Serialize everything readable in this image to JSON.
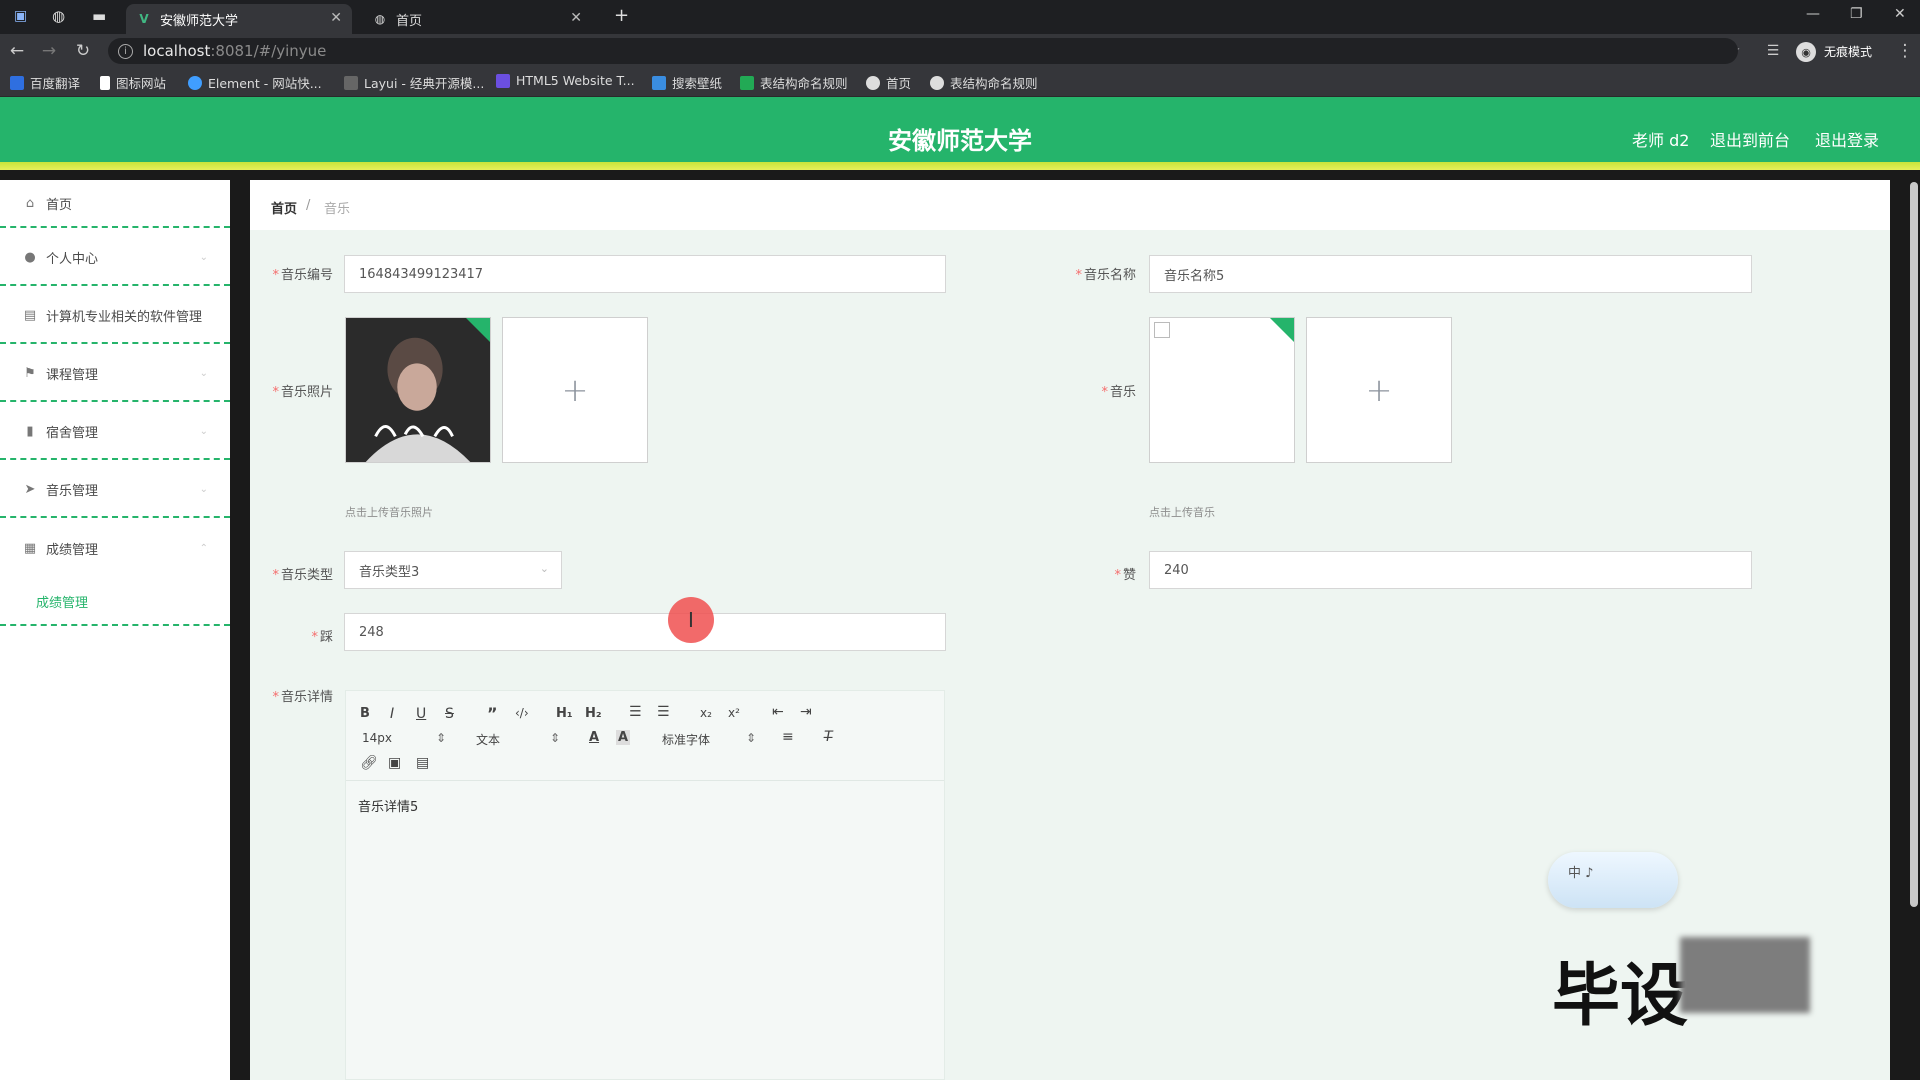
{
  "browser": {
    "tabs": [
      {
        "title": "安徽师范大学",
        "active": true
      },
      {
        "title": "首页",
        "active": false
      }
    ],
    "url_host": "localhost",
    "url_path": ":8081/#/yinyue",
    "profile_label": "无痕模式",
    "bookmarks": [
      {
        "label": "百度翻译",
        "color": "#2f6fe0"
      },
      {
        "label": "图标网站",
        "color": "#ffffff"
      },
      {
        "label": "Element - 网站快...",
        "color": "#409eff"
      },
      {
        "label": "Layui - 经典开源模...",
        "color": "#dddddd"
      },
      {
        "label": "HTML5 Website T...",
        "color": "#6b4fe0"
      },
      {
        "label": "搜索壁纸",
        "color": "#3a8de0"
      },
      {
        "label": "表结构命名规则",
        "color": "#22aa55"
      },
      {
        "label": "首页",
        "color": "#dddddd"
      },
      {
        "label": "表结构命名规则",
        "color": "#dddddd"
      }
    ]
  },
  "header": {
    "title": "安徽师范大学",
    "user": "老师 d2",
    "to_front": "退出到前台",
    "logout": "退出登录",
    "color": "#25b46b"
  },
  "sidebar": {
    "items": [
      {
        "label": "首页",
        "icon": "home-icon"
      },
      {
        "label": "个人中心",
        "icon": "user-icon"
      },
      {
        "label": "计算机专业相关的软件管理",
        "icon": "printer-icon"
      },
      {
        "label": "课程管理",
        "icon": "flag-icon"
      },
      {
        "label": "宿舍管理",
        "icon": "bar-chart-icon"
      },
      {
        "label": "音乐管理",
        "icon": "send-icon"
      },
      {
        "label": "成绩管理",
        "icon": "grid-icon"
      }
    ],
    "sub_item": "成绩管理"
  },
  "breadcrumb": {
    "home": "首页",
    "separator": "/",
    "current": "音乐"
  },
  "form": {
    "music_no_label": "音乐编号",
    "music_no_value": "1648434991234­17",
    "music_name_label": "音乐名称",
    "music_name_value": "音乐名称5",
    "photo_label": "音乐照片",
    "photo_hint": "点击上传音乐照片",
    "music_label": "音乐",
    "music_hint": "点击上传音乐",
    "type_label": "音乐类型",
    "type_value": "音乐类型3",
    "field_a_label": "赞",
    "field_a_value": "240",
    "field_b_label": "踩",
    "field_b_value": "248",
    "detail_label": "音乐详情",
    "detail_value": "音乐详情5"
  },
  "editor": {
    "font_size": "14px",
    "paragraph": "文本",
    "font_family": "标准字体"
  },
  "overlay": {
    "ime": "中 ♪",
    "watermark": "毕设"
  }
}
